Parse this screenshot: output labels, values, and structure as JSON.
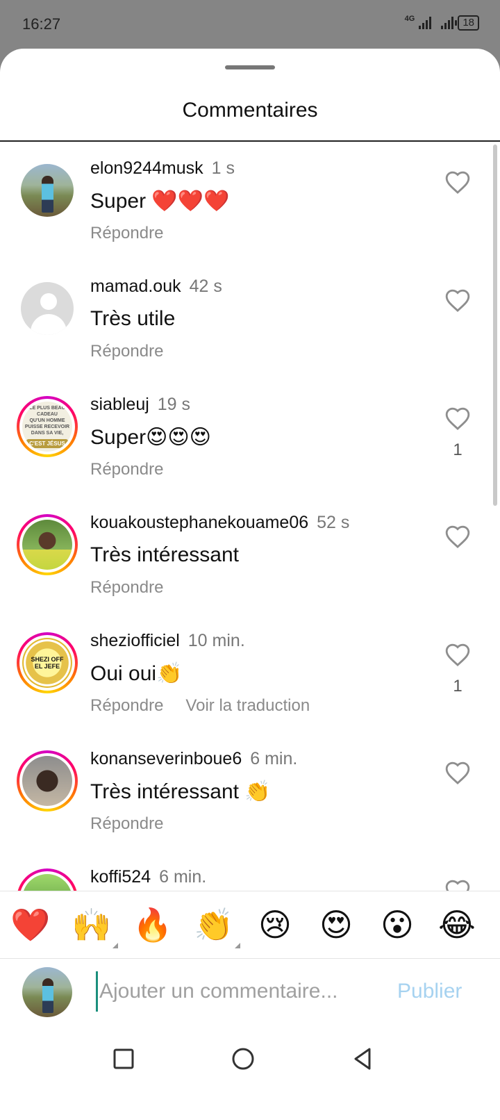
{
  "status_bar": {
    "time": "16:27",
    "network": "4G",
    "battery": "18"
  },
  "sheet": {
    "title": "Commentaires"
  },
  "comments": [
    {
      "user": "elon9244musk",
      "time": "1 s",
      "text": "Super ❤️❤️❤️",
      "reply": "Répondre",
      "likes": ""
    },
    {
      "user": "mamad.ouk",
      "time": "42 s",
      "text": "Très utile",
      "reply": "Répondre",
      "likes": ""
    },
    {
      "user": "siableuj",
      "time": "19 s",
      "text": "Super😍😍😍",
      "reply": "Répondre",
      "likes": "1"
    },
    {
      "user": "kouakoustephanekouame06",
      "time": "52 s",
      "text": "Très intéressant",
      "reply": "Répondre",
      "likes": ""
    },
    {
      "user": "sheziofficiel",
      "time": "10 min.",
      "text": "Oui oui👏",
      "reply": "Répondre",
      "translate": "Voir la traduction",
      "likes": "1"
    },
    {
      "user": "konanseverinboue6",
      "time": "6 min.",
      "text": "Très intéressant 👏",
      "reply": "Répondre",
      "likes": ""
    },
    {
      "user": "koffi524",
      "time": "6 min.",
      "text": "",
      "reply": "",
      "likes": ""
    }
  ],
  "avatar_labels": {
    "siableuj_lines": [
      "LE PLUS BEAU CADEAU",
      "QU'UN HOMME PUISSE RECEVOIR",
      "DANS SA VIE,"
    ],
    "siableuj_highlight": "C'EST JÉSUS",
    "shezi_top": "SHEZI OFF",
    "shezi_bottom": "EL JEFE"
  },
  "emoji_bar": [
    "❤️",
    "🙌",
    "🔥",
    "👏",
    "😢",
    "😍",
    "😮",
    "😂"
  ],
  "composer": {
    "placeholder": "Ajouter un commentaire...",
    "publish_label": "Publier"
  },
  "colors": {
    "publish": "#a6d2f0",
    "accent_cursor": "#1a8f7c",
    "heart": "#e0245e"
  }
}
